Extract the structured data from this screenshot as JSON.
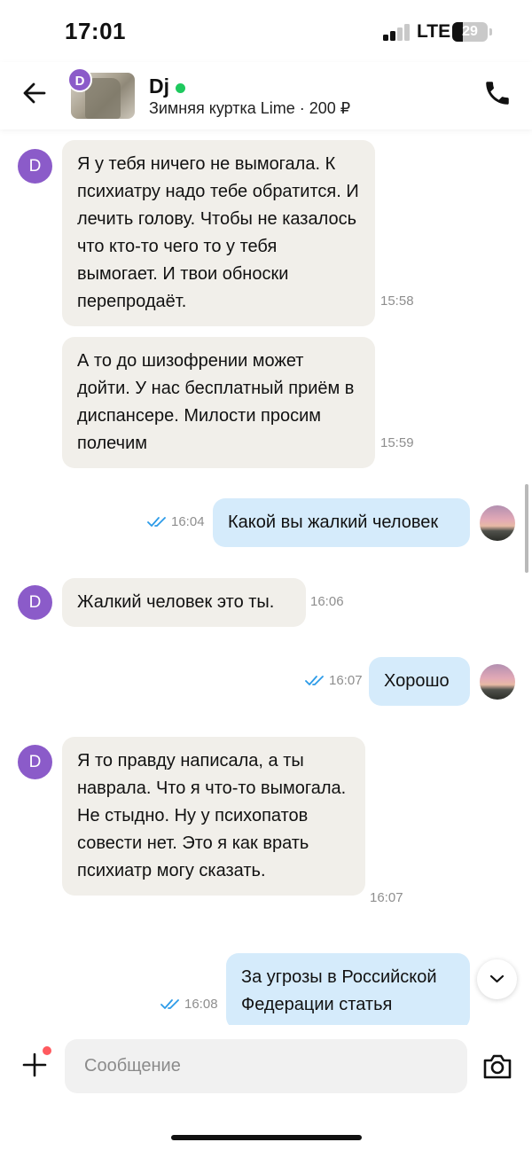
{
  "status_bar": {
    "time": "17:01",
    "network": "LTE",
    "battery": "29"
  },
  "header": {
    "avatar_letter": "D",
    "name": "Dj",
    "subtitle": "Зимняя куртка Lime · 200 ₽"
  },
  "messages": [
    {
      "direction": "in",
      "avatar": "D",
      "text": "Я у тебя  ничего  не вымогала. К психиатру надо тебе обратится. И лечить голову. Чтобы не казалось что кто-то чего то у тебя вымогает. И твои обноски перепродаёт.",
      "time": "15:58"
    },
    {
      "direction": "in",
      "text": "А то до шизофрении может дойти. У нас бесплатный приём в диспансере. Милости просим полечим",
      "time": "15:59"
    },
    {
      "direction": "out",
      "text": "Какой вы жалкий человек",
      "time": "16:04",
      "read": true
    },
    {
      "direction": "in",
      "avatar": "D",
      "text": "Жалкий человек это ты.",
      "time": "16:06"
    },
    {
      "direction": "out",
      "text": "Хорошо",
      "time": "16:07",
      "read": true
    },
    {
      "direction": "in",
      "avatar": "D",
      "text": "Я то правду написала,  а ты наврала. Что я что-то вымогала.  Не стыдно. Ну у психопатов совести нет. Это я как врать психиатр могу сказать.",
      "time": "16:07"
    },
    {
      "direction": "out",
      "text": "За угрозы в Российской Федерации статья",
      "time": "16:08",
      "read": true
    }
  ],
  "composer": {
    "placeholder": "Сообщение"
  },
  "colors": {
    "accent_purple": "#8b5bc9",
    "online_green": "#1ec95e",
    "outgoing_bubble": "#d5ebfb",
    "incoming_bubble": "#f1efea",
    "read_check_blue": "#2c9be8",
    "notification_dot": "#ff5a5f"
  },
  "icons": [
    "back-arrow-icon",
    "phone-icon",
    "double-check-icon",
    "chevron-down-icon",
    "plus-icon",
    "camera-icon"
  ]
}
